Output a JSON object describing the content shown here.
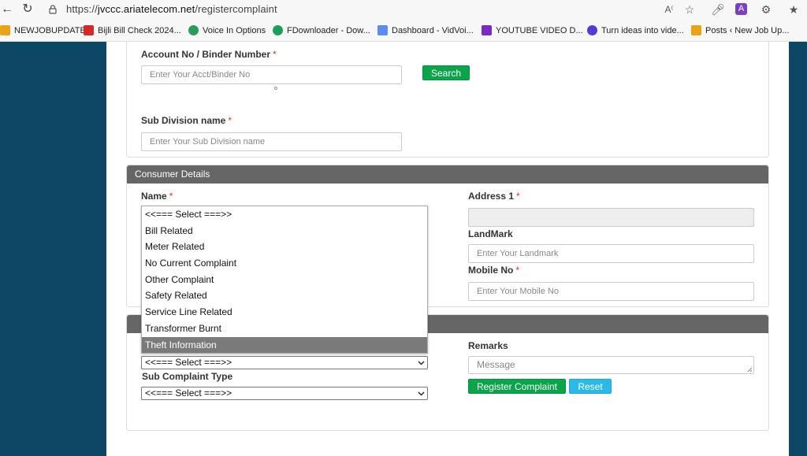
{
  "browser": {
    "url_prefix": "https://",
    "url_host": "jvccc.ariatelecom.net",
    "url_path": "/registercomplaint",
    "bookmarks": [
      {
        "label": "NEWJOBUPDATE",
        "color": "#e8a317"
      },
      {
        "label": "Bijli Bill Check 2024...",
        "color": "#d62828"
      },
      {
        "label": "Voice In Options",
        "color": "#2a9d5c"
      },
      {
        "label": "FDownloader - Dow...",
        "color": "#1aa05a"
      },
      {
        "label": "Dashboard - VidVoi...",
        "color": "#5b8def"
      },
      {
        "label": "YOUTUBE VIDEO D...",
        "color": "#7b2cbf"
      },
      {
        "label": "Turn ideas into vide...",
        "color": "#4c3fd1"
      },
      {
        "label": "Posts ‹ New Job Up...",
        "color": "#e8a317"
      }
    ]
  },
  "account": {
    "label": "Account No / Binder Number",
    "placeholder": "Enter Your Acct/Binder No",
    "search_label": "Search"
  },
  "subdivision": {
    "label": "Sub Division name",
    "placeholder": "Enter Your Sub Division name"
  },
  "consumer": {
    "title": "Consumer Details",
    "name_label": "Name",
    "address_label": "Address 1",
    "landmark_label": "LandMark",
    "landmark_placeholder": "Enter Your Landmark",
    "mobile_label": "Mobile No",
    "mobile_placeholder": "Enter Your Mobile No"
  },
  "dropdown": {
    "options": [
      "<<=== Select ===>>",
      "Bill Related",
      "Meter Related",
      "No Current Complaint",
      "Other Complaint",
      "Safety Related",
      "Service Line Related",
      "Transformer Burnt",
      "Theft Information"
    ],
    "selected_index": 8
  },
  "complaint": {
    "type_value": "<<=== Select ===>>",
    "sub_type_label": "Sub Complaint Type",
    "sub_type_value": "<<=== Select ===>>",
    "remarks_label": "Remarks",
    "remarks_placeholder": "Message",
    "register_label": "Register Complaint",
    "reset_label": "Reset"
  },
  "colors": {
    "background": "#0c4866",
    "panel_header": "#666666",
    "button_green": "#0aa54b",
    "button_blue": "#2bb9e8",
    "required": "#e0312c"
  }
}
